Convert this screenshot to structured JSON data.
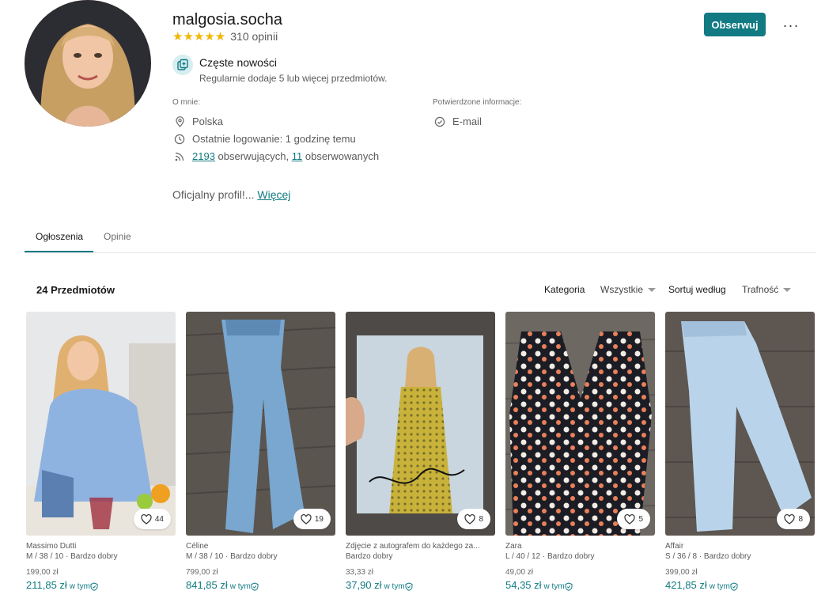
{
  "profile": {
    "username": "malgosia.socha",
    "stars": "★★★★★",
    "reviews": "310 opinii",
    "follow_label": "Obserwuj",
    "more_label": "···",
    "badge": {
      "title": "Częste nowości",
      "description": "Regularnie dodaje 5 lub więcej przedmiotów."
    },
    "about": {
      "label": "O mnie:",
      "country": "Polska",
      "last_login": "Ostatnie logowanie: 1 godzinę temu",
      "followers_count": "2193",
      "followers_text": " obserwujących, ",
      "following_count": "11",
      "following_text": " obserwowanych"
    },
    "verified": {
      "label": "Potwierdzone informacje:",
      "email": "E-mail"
    },
    "bio_text": "Oficjalny profil!... ",
    "bio_more": "Więcej"
  },
  "tabs": [
    {
      "label": "Ogłoszenia",
      "active": true
    },
    {
      "label": "Opinie",
      "active": false
    }
  ],
  "listing": {
    "count": "24 Przedmiotów",
    "category_label": "Kategoria",
    "category_value": "Wszystkie",
    "sort_label": "Sortuj według",
    "sort_value": "Trafność"
  },
  "items": [
    {
      "brand": "Massimo Dutti",
      "meta": "M / 38 / 10 · Bardzo dobry",
      "price": "199,00 zł",
      "total": "211,85 zł",
      "incl": "w tym",
      "favs": "44"
    },
    {
      "brand": "Céline",
      "meta": "M / 38 / 10 · Bardzo dobry",
      "price": "799,00 zł",
      "total": "841,85 zł",
      "incl": "w tym",
      "favs": "19"
    },
    {
      "brand": "Zdjęcie z autografem do każdego za...",
      "meta": "Bardzo dobry",
      "price": "33,33 zł",
      "total": "37,90 zł",
      "incl": "w tym",
      "favs": "8"
    },
    {
      "brand": "Zara",
      "meta": "L / 40 / 12 · Bardzo dobry",
      "price": "49,00 zł",
      "total": "54,35 zł",
      "incl": "w tym",
      "favs": "5"
    },
    {
      "brand": "Affair",
      "meta": "S / 36 / 8 · Bardzo dobry",
      "price": "399,00 zł",
      "total": "421,85 zł",
      "incl": "w tym",
      "favs": "8"
    }
  ],
  "colors": {
    "accent": "#117a83",
    "star": "#f2b705",
    "text": "#171717",
    "muted": "#5a5a5a"
  }
}
